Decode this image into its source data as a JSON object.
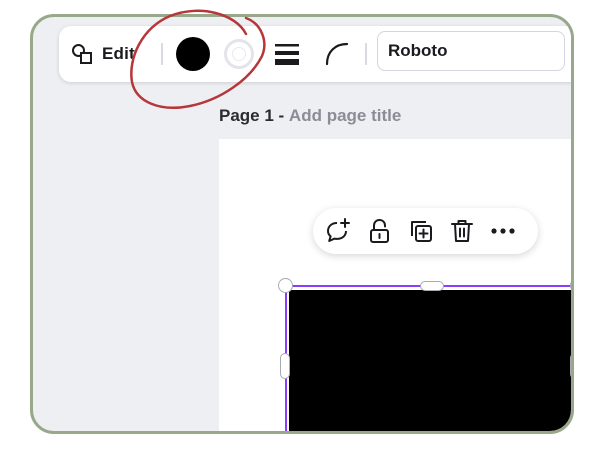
{
  "toolbar": {
    "edit_label": "Edit",
    "fill_color": "#000000",
    "font_name": "Roboto",
    "icons": [
      "shapes-icon",
      "border-style-icon",
      "corner-rounding-icon"
    ]
  },
  "page": {
    "number_label": "Page 1",
    "separator": " - ",
    "title_placeholder": "Add page title"
  },
  "context_menu": {
    "icons": [
      "comment-add-icon",
      "unlock-icon",
      "duplicate-icon",
      "trash-icon",
      "more-icon"
    ]
  },
  "selection": {
    "accent_color": "#8b3dff",
    "shape_fill": "#000000"
  },
  "annotation": {
    "color": "#b5373a"
  }
}
